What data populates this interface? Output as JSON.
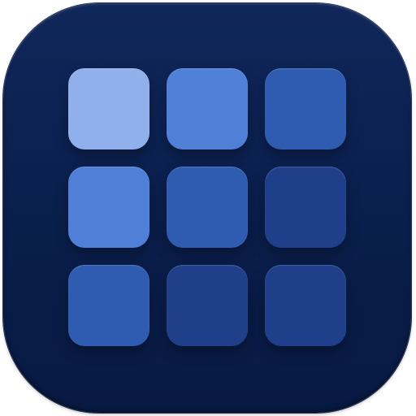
{
  "icon": {
    "name": "grid-app-icon",
    "background_color": "#0b2150",
    "tiles": [
      {
        "color": "#8fb0ea"
      },
      {
        "color": "#4f7fd6"
      },
      {
        "color": "#2f5bb0"
      },
      {
        "color": "#4f7fd6"
      },
      {
        "color": "#2f5bb0"
      },
      {
        "color": "#1f3f8a"
      },
      {
        "color": "#2f5bb0"
      },
      {
        "color": "#1f3f8a"
      },
      {
        "color": "#1f3f8a"
      }
    ]
  }
}
